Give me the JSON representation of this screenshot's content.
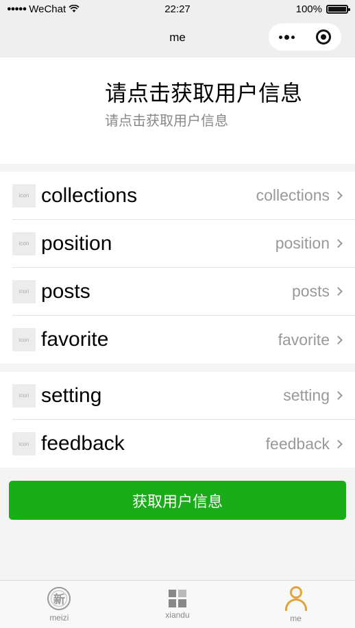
{
  "status_bar": {
    "carrier": "WeChat",
    "time": "22:27",
    "battery": "100%"
  },
  "nav": {
    "title": "me"
  },
  "user": {
    "title": "请点击获取用户信息",
    "subtitle": "请点击获取用户信息"
  },
  "menu_group1": [
    {
      "icon_text": "icon",
      "label": "collections",
      "value": "collections"
    },
    {
      "icon_text": "icon",
      "label": "position",
      "value": "position"
    },
    {
      "icon_text": "icon",
      "label": "posts",
      "value": "posts"
    },
    {
      "icon_text": "icon",
      "label": "favorite",
      "value": "favorite"
    }
  ],
  "menu_group2": [
    {
      "icon_text": "icon",
      "label": "setting",
      "value": "setting"
    },
    {
      "icon_text": "icon",
      "label": "feedback",
      "value": "feedback"
    }
  ],
  "primary_button": "获取用户信息",
  "tabbar": {
    "items": [
      {
        "label": "meizi",
        "icon": "new-badge-icon",
        "glyph": "新"
      },
      {
        "label": "xiandu",
        "icon": "grid-icon"
      },
      {
        "label": "me",
        "icon": "person-icon",
        "active": true
      }
    ],
    "active_color": "#e3a33c"
  },
  "colors": {
    "primary": "#1aad19",
    "background": "#f4f4f4"
  }
}
